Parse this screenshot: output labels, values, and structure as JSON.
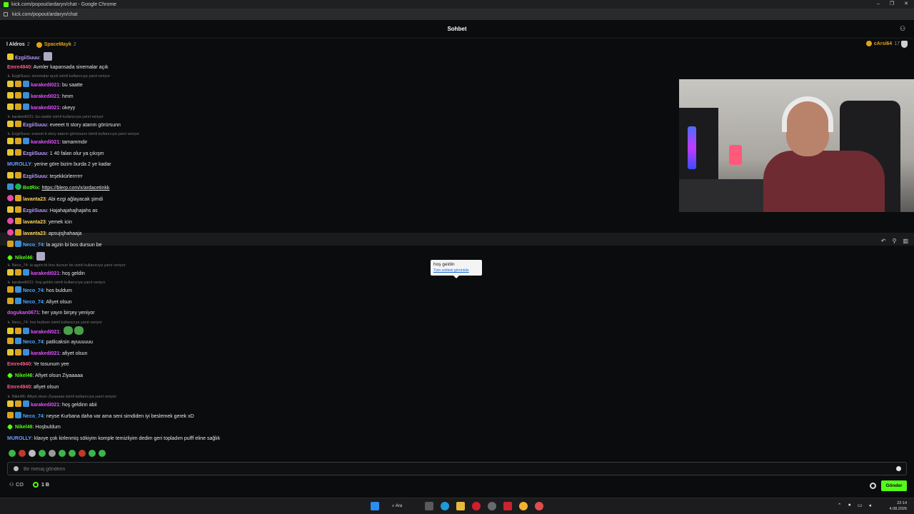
{
  "browser": {
    "window_title": "kick.com/popout/ardaryn/chat - Google Chrome",
    "url": "kick.com/popout/ardaryn/chat",
    "controls": [
      "–",
      "❐",
      "✕"
    ]
  },
  "chat": {
    "title": "Sohbet",
    "gifters_left": [
      {
        "name": "l Aldros",
        "count": "2",
        "color": "#ffffff"
      },
      {
        "name": "SpaceMayk",
        "count": "2",
        "color": "#e0a31a"
      }
    ],
    "gifter_right": {
      "name": "cArsi64",
      "count": "17",
      "color": "#e0a31a"
    }
  },
  "messages": [
    {
      "badges": [
        "sub"
      ],
      "user": "EzgiiSuuu",
      "color": "#b99cff",
      "text": "",
      "emote": "plain"
    },
    {
      "badges": [],
      "user": "Emre4940",
      "color": "#ff5c8a",
      "text": "Avmler kapansada sinemalar açık"
    },
    {
      "reply": "EzgiiSuuu: sinemalar açıık isimli kullanıcıya yanıt veriyor"
    },
    {
      "badges": [
        "sub",
        "crown",
        "verified"
      ],
      "user": "karakedi021",
      "color": "#e052ff",
      "text": "bu saatte"
    },
    {
      "badges": [
        "sub",
        "crown",
        "verified"
      ],
      "user": "karakedi021",
      "color": "#e052ff",
      "text": "hmm"
    },
    {
      "badges": [
        "sub",
        "crown",
        "verified"
      ],
      "user": "karakedi021",
      "color": "#e052ff",
      "text": "okeyy"
    },
    {
      "reply": "karakedi021: bu saatte isimli kullanıcıya yanıt veriyor"
    },
    {
      "badges": [
        "sub",
        "crown"
      ],
      "user": "EzgiiSuuu",
      "color": "#b99cff",
      "text": "eveeet tt story atarım görürsunn"
    },
    {
      "reply": "EzgiiSuuu: eveeet tt story atarım görürsunn isimli kullanıcıya yanıt veriyor"
    },
    {
      "badges": [
        "sub",
        "crown",
        "verified"
      ],
      "user": "karakedi021",
      "color": "#e052ff",
      "text": "tamammdır"
    },
    {
      "badges": [
        "sub",
        "crown"
      ],
      "user": "EzgiiSuuu",
      "color": "#b99cff",
      "text": "1 40 falan olur ya çıkışm"
    },
    {
      "badges": [],
      "user": "MUROLLY",
      "color": "#6f9cff",
      "text": "yerine göre bizim burda 2 ye kadar"
    },
    {
      "badges": [
        "sub",
        "crown"
      ],
      "user": "EzgiiSuuu",
      "color": "#b99cff",
      "text": "teşekkürlerrrrrr"
    },
    {
      "badges": [
        "verified",
        "bot"
      ],
      "user": "BotRix",
      "color": "#53fc18",
      "text": "",
      "link": "https://blerp.com/x/ardacetinkk"
    },
    {
      "badges": [
        "pink",
        "crown"
      ],
      "user": "lavanta23",
      "color": "#ffd75c",
      "text": "Abi ezgi ağlayacak şimdi"
    },
    {
      "badges": [
        "sub",
        "crown"
      ],
      "user": "EzgiiSuuu",
      "color": "#b99cff",
      "text": "Hajahajahajhajahs as"
    },
    {
      "badges": [
        "pink",
        "crown"
      ],
      "user": "lavanta23",
      "color": "#ffd75c",
      "text": "yemek icin"
    },
    {
      "badges": [
        "pink",
        "crown"
      ],
      "user": "lavanta23",
      "color": "#ffd75c",
      "text": "apsujsjhahaaja"
    },
    {
      "badges": [
        "crown",
        "verified"
      ],
      "user": "Neco_74",
      "color": "#4aa7ff",
      "text": "la agzin bi bos dursun be"
    },
    {
      "badges": [
        "kick"
      ],
      "user": "Nikel46",
      "color": "#53fc18",
      "text": "",
      "emote": "plain"
    },
    {
      "reply": "Neco_74: la agzin bi bos dursun be isimli kullanıcıya yanıt veriyor"
    },
    {
      "badges": [
        "sub",
        "crown",
        "verified"
      ],
      "user": "karakedi021",
      "color": "#e052ff",
      "text": "hoş geldin"
    },
    {
      "reply": "karakedi021: hoş geldin isimli kullanıcıya yanıt veriyor"
    },
    {
      "badges": [
        "crown",
        "verified"
      ],
      "user": "Neco_74",
      "color": "#4aa7ff",
      "text": "hos buldum"
    },
    {
      "badges": [
        "crown",
        "verified"
      ],
      "user": "Neco_74",
      "color": "#4aa7ff",
      "text": "Afiyet olsun"
    },
    {
      "badges": [],
      "user": "dogukan0671",
      "color": "#e052ff",
      "text": "her yayın birşey yeniyor"
    },
    {
      "reply": "Neco_74: hos buldum isimli kullanıcıya yanıt veriyor"
    },
    {
      "badges": [
        "sub",
        "crown",
        "verified"
      ],
      "user": "karakedi021",
      "color": "#e052ff",
      "text": "",
      "emote": "frog"
    },
    {
      "badges": [
        "crown",
        "verified"
      ],
      "user": "Neco_74",
      "color": "#4aa7ff",
      "text": "patlicaksin ayuuuuuu"
    },
    {
      "badges": [
        "sub",
        "crown",
        "verified"
      ],
      "user": "karakedi021",
      "color": "#e052ff",
      "text": "afiyet olsun"
    },
    {
      "badges": [],
      "user": "Emre4940",
      "color": "#ff5c8a",
      "text": "Ye tosunum yee"
    },
    {
      "badges": [
        "kick"
      ],
      "user": "Nikel46",
      "color": "#53fc18",
      "text": "Afiyet olsun Ziyaaaaa"
    },
    {
      "badges": [],
      "user": "Emre4940",
      "color": "#ff5c8a",
      "text": "afiyet olsun"
    },
    {
      "reply": "Nikel46: Afiyet olsun Ziyaaaaa isimli kullanıcıya yanıt veriyor"
    },
    {
      "badges": [
        "sub",
        "crown",
        "verified"
      ],
      "user": "karakedi021",
      "color": "#e052ff",
      "text": "hoş geldinn abii"
    },
    {
      "badges": [
        "crown",
        "verified"
      ],
      "user": "Neco_74",
      "color": "#4aa7ff",
      "text": "neyse Kurbana daha var ama seni simdiden iyi beslemek gerek xD"
    },
    {
      "badges": [
        "kick"
      ],
      "user": "Nikel46",
      "color": "#53fc18",
      "text": "Hoşbuldum"
    },
    {
      "badges": [],
      "user": "MUROLLY",
      "color": "#6f9cff",
      "text": "klavye çok kirlenmiş sökiyim komple temizliyim dedim geri topladım pufff eline sağlık"
    }
  ],
  "tooltip": {
    "line1": "hoş geldin",
    "line2": "Tüm sohbeti görüntüle"
  },
  "input": {
    "placeholder": "Bir mesaj gönderin"
  },
  "footer": {
    "viewers": "CO",
    "points": "1 B",
    "send_label": "Gönder"
  },
  "taskbar": {
    "search_label": "Ara",
    "time": "22:14",
    "date": "4.08.2026"
  },
  "colors": {
    "brand": "#53fc18",
    "background": "#0b0c0d"
  }
}
